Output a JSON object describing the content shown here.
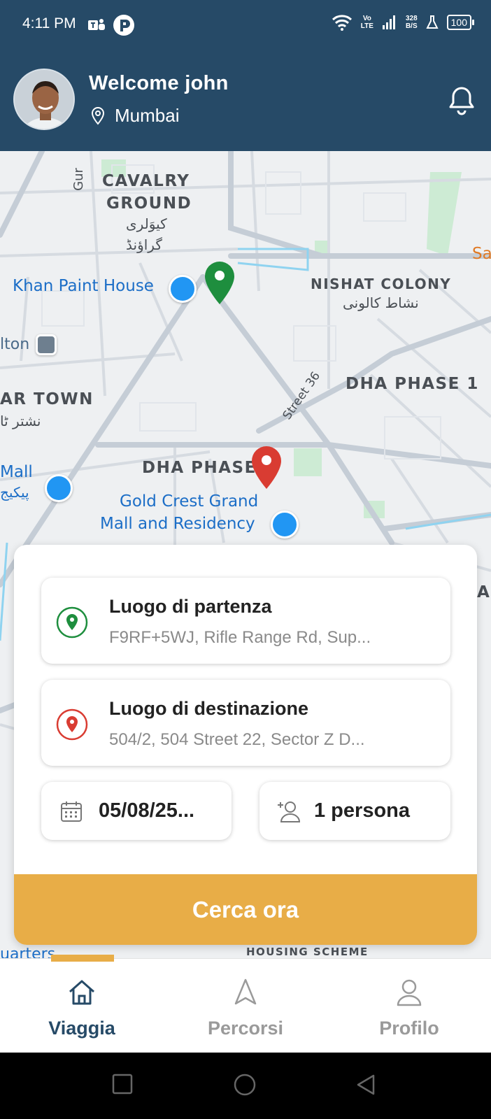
{
  "status_bar": {
    "time": "4:11 PM",
    "network": {
      "volte_top": "Vo",
      "volte_bottom": "LTE"
    },
    "speed": {
      "value": "328",
      "unit": "B/S"
    },
    "battery": "100"
  },
  "header": {
    "welcome": "Welcome john",
    "location": "Mumbai",
    "background_color": "#264a67"
  },
  "map": {
    "labels": {
      "gur": "Gur",
      "cavalry1": "CAVALRY",
      "cavalry2": "GROUND",
      "cavalry_urdu1": "کیوَلری",
      "cavalry_urdu2": "گراؤنڈ",
      "khan": "Khan Paint House",
      "nishat": "NISHAT COLONY",
      "nishat_urdu": "نشاط کالونی",
      "sa": "Sa",
      "lton": "lton",
      "dha1": "DHA PHASE 1",
      "artown": "AR TOWN",
      "artown_urdu": "نشتر ٹا",
      "street36": "Street 36",
      "mall": "Mall",
      "mall_urdu": "پیکیج",
      "dha_phase": "DHA PHASE 8",
      "gold1": "Gold Crest Grand",
      "gold2": "Mall and Residency",
      "quarters": "uarters",
      "housing": "HOUSING SCHEME",
      "as_edge": "AS"
    }
  },
  "search_card": {
    "departure": {
      "title": "Luogo di partenza",
      "value": "F9RF+5WJ, Rifle Range Rd, Sup..."
    },
    "destination": {
      "title": "Luogo di destinazione",
      "value": "504/2, 504 Street 22, Sector Z D..."
    },
    "date": "05/08/25...",
    "passengers": "1 persona",
    "search_button": "Cerca ora",
    "accent_color": "#e8ad47"
  },
  "bottom_nav": {
    "items": [
      {
        "label": "Viaggia",
        "icon": "home-icon",
        "active": true
      },
      {
        "label": "Percorsi",
        "icon": "navigation-arrow-icon",
        "active": false
      },
      {
        "label": "Profilo",
        "icon": "person-icon",
        "active": false
      }
    ]
  }
}
